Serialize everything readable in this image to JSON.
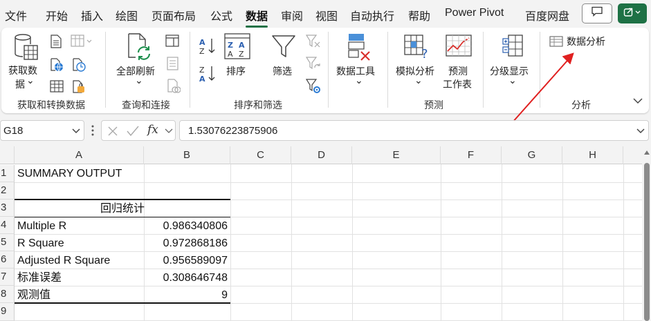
{
  "menu": {
    "tabs": [
      {
        "label": "文件"
      },
      {
        "label": "开始"
      },
      {
        "label": "插入"
      },
      {
        "label": "绘图"
      },
      {
        "label": "页面布局"
      },
      {
        "label": "公式"
      },
      {
        "label": "数据"
      },
      {
        "label": "审阅"
      },
      {
        "label": "视图"
      },
      {
        "label": "自动执行"
      },
      {
        "label": "帮助"
      },
      {
        "label": "Power Pivot"
      },
      {
        "label": "百度网盘"
      }
    ],
    "active_tab": "数据"
  },
  "ribbon": {
    "get_data": {
      "line1": "获取数",
      "line2": "据",
      "arrow": "⌄"
    },
    "refresh_all": {
      "label": "全部刷新",
      "arrow": "⌄"
    },
    "sort": {
      "label": "排序"
    },
    "filter": {
      "label": "筛选"
    },
    "data_tools": {
      "label": "数据工具",
      "arrow": "⌄"
    },
    "what_if": {
      "label": "模拟分析",
      "arrow": "⌄"
    },
    "forecast_sheet": {
      "line1": "预测",
      "line2": "工作表"
    },
    "outline": {
      "label": "分级显示",
      "arrow": "⌄"
    },
    "data_analysis": {
      "label": "数据分析"
    },
    "groups": {
      "get_transform": "获取和转换数据",
      "queries": "查询和连接",
      "sort_filter": "排序和筛选",
      "forecast": "预测",
      "analysis": "分析"
    },
    "colors": {
      "accent": "#1e7145",
      "annotation_arrow": "#e02020"
    }
  },
  "formula_bar": {
    "name_box": "G18",
    "fx": "fx",
    "value": "1.53076223875906"
  },
  "grid": {
    "columns": [
      "A",
      "B",
      "C",
      "D",
      "E",
      "F",
      "G",
      "H"
    ],
    "rows": [
      "1",
      "2",
      "3",
      "4",
      "5",
      "6",
      "7",
      "8",
      "9"
    ],
    "cells": {
      "a1": "SUMMARY OUTPUT",
      "a3": "回归统计",
      "a4": "Multiple R",
      "b4": "0.986340806",
      "a5": "R Square",
      "b5": "0.972868186",
      "a6": "Adjusted R Square",
      "b6": "0.956589097",
      "a7": "标准误差",
      "b7": "0.308646748",
      "a8": "观测值",
      "b8": "9"
    }
  }
}
